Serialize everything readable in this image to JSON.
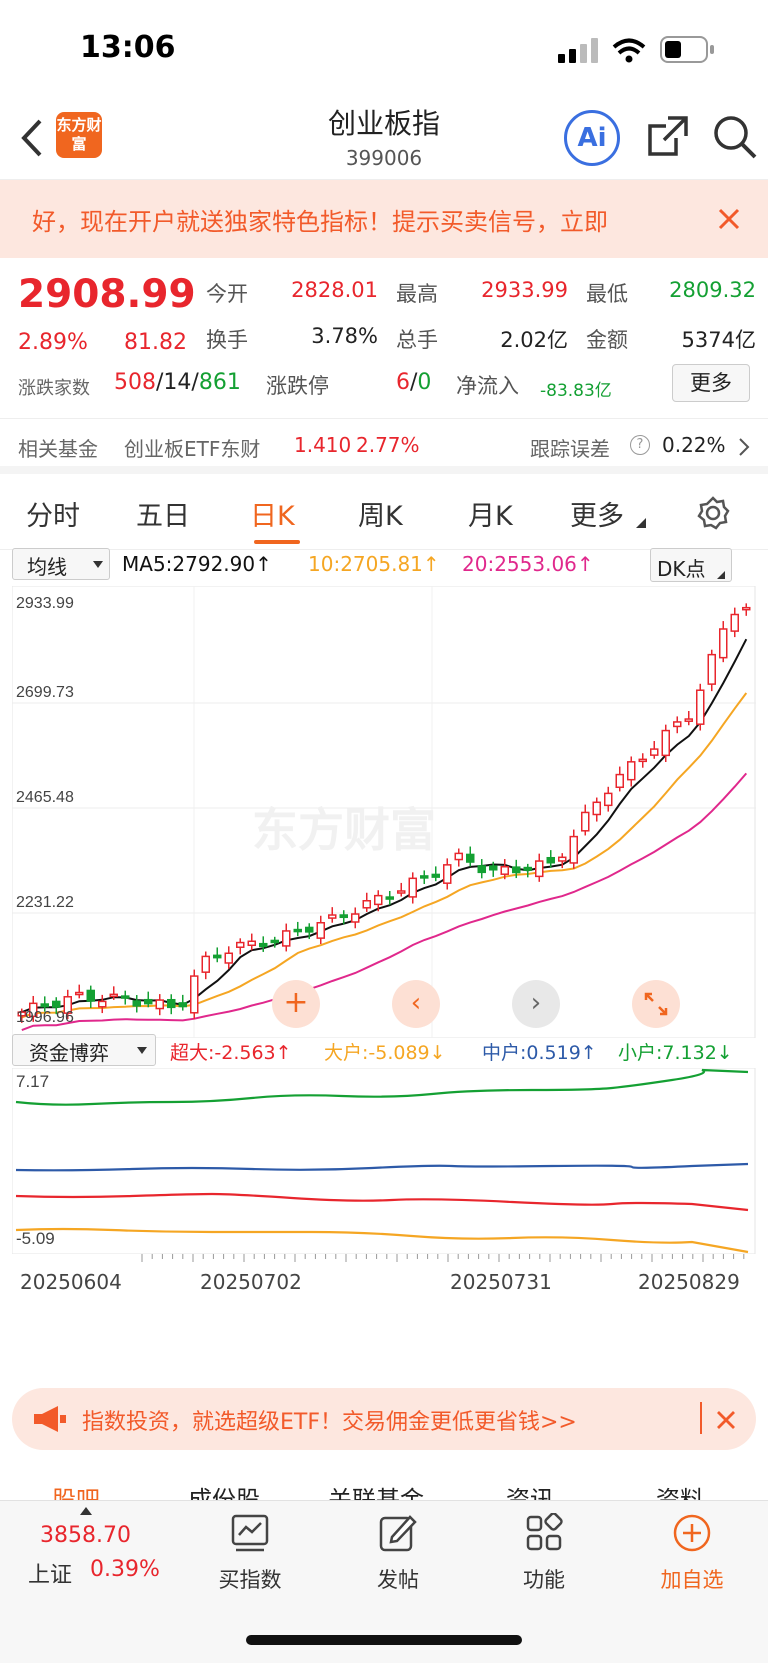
{
  "status": {
    "time": "13:06"
  },
  "header": {
    "app_logo": "东方财富",
    "title": "创业板指",
    "code": "399006",
    "ai_label": "Ai"
  },
  "promo_banner": {
    "text": "好，现在开户就送独家特色指标！提示买卖信号，立即"
  },
  "quote": {
    "price": "2908.99",
    "change_pct": "2.89%",
    "change_abs": "81.82",
    "labels": {
      "open": "今开",
      "high": "最高",
      "low": "最低",
      "turnover_rate": "换手",
      "volume": "总手",
      "amount": "金额",
      "breadth": "涨跌家数",
      "limit": "涨跌停",
      "net_inflow": "净流入"
    },
    "open": "2828.01",
    "high": "2933.99",
    "low": "2809.32",
    "turnover_rate": "3.78%",
    "volume": "2.02亿",
    "amount": "5374亿",
    "up": "508",
    "flat": "14",
    "down": "861",
    "limit_up": "6",
    "limit_down": "0",
    "net_inflow": "-83.83亿",
    "more": "更多"
  },
  "fund": {
    "label": "相关基金",
    "name": "创业板ETF东财",
    "price": "1.410",
    "pct": "2.77%",
    "err_label": "跟踪误差",
    "err_value": "0.22%"
  },
  "tabs": [
    "分时",
    "五日",
    "日K",
    "周K",
    "月K",
    "更多"
  ],
  "active_tab": "日K",
  "ma_bar": {
    "selector": "均线",
    "ma5": "MA5:2792.90↑",
    "ma10": "10:2705.81↑",
    "ma20": "20:2553.06↑",
    "dk": "DK点"
  },
  "kline": {
    "y_labels": [
      "2933.99",
      "2699.73",
      "2465.48",
      "2231.22",
      "1996.96"
    ],
    "watermark": "东方财富",
    "colors": {
      "up": "#e8262d",
      "down": "#14a033",
      "ma5": "#111111",
      "ma10": "#f5a623",
      "ma20": "#e0288c"
    }
  },
  "capital": {
    "selector": "资金博弈",
    "super": "超大:-2.563↑",
    "large": "大户:-5.089↓",
    "mid": "中户:0.519↑",
    "small": "小户:7.132↓",
    "y_top": "7.17",
    "y_bottom": "-5.09"
  },
  "dates": [
    "20250604",
    "20250702",
    "20250731",
    "20250829"
  ],
  "ad2": {
    "text": "指数投资，就选超级ETF！交易佣金更低更省钱>>"
  },
  "subtabs": [
    "股吧",
    "成份股",
    "关联基金",
    "资讯",
    "资料"
  ],
  "bottom": {
    "index_value": "3858.70",
    "index_name": "上证",
    "index_pct": "0.39%",
    "buy": "买指数",
    "post": "发帖",
    "func": "功能",
    "add": "加自选"
  }
}
